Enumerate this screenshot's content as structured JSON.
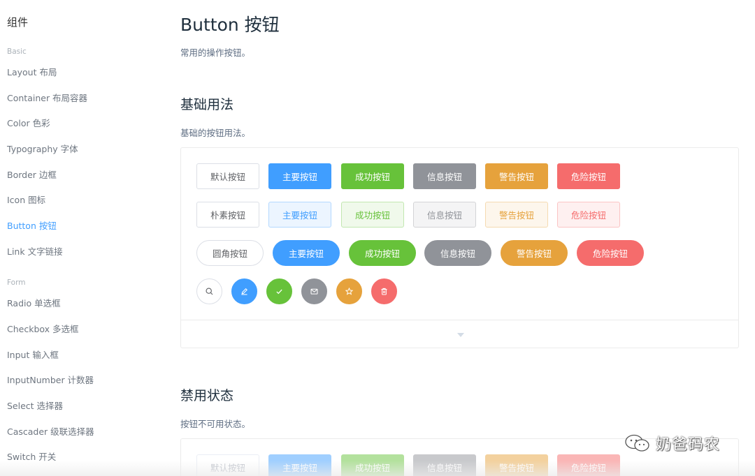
{
  "sidebar": {
    "title": "组件",
    "groups": [
      {
        "label": "Basic",
        "items": [
          {
            "label": "Layout 布局"
          },
          {
            "label": "Container 布局容器"
          },
          {
            "label": "Color 色彩"
          },
          {
            "label": "Typography 字体"
          },
          {
            "label": "Border 边框"
          },
          {
            "label": "Icon 图标"
          },
          {
            "label": "Button 按钮",
            "active": true
          },
          {
            "label": "Link 文字链接"
          }
        ]
      },
      {
        "label": "Form",
        "items": [
          {
            "label": "Radio 单选框"
          },
          {
            "label": "Checkbox 多选框"
          },
          {
            "label": "Input 输入框"
          },
          {
            "label": "InputNumber 计数器"
          },
          {
            "label": "Select 选择器"
          },
          {
            "label": "Cascader 级联选择器"
          },
          {
            "label": "Switch 开关"
          }
        ]
      }
    ]
  },
  "main": {
    "title": "Button 按钮",
    "description": "常用的操作按钮。",
    "sections": [
      {
        "heading": "基础用法",
        "description": "基础的按钮用法。",
        "rows": [
          {
            "kind": "default",
            "labels": [
              "默认按钮",
              "主要按钮",
              "成功按钮",
              "信息按钮",
              "警告按钮",
              "危险按钮"
            ]
          },
          {
            "kind": "plain",
            "labels": [
              "朴素按钮",
              "主要按钮",
              "成功按钮",
              "信息按钮",
              "警告按钮",
              "危险按钮"
            ]
          },
          {
            "kind": "round",
            "labels": [
              "圆角按钮",
              "主要按钮",
              "成功按钮",
              "信息按钮",
              "警告按钮",
              "危险按钮"
            ]
          },
          {
            "kind": "circle",
            "icons": [
              "search-icon",
              "edit-icon",
              "check-icon",
              "message-icon",
              "star-icon",
              "delete-icon"
            ]
          }
        ]
      },
      {
        "heading": "禁用状态",
        "description": "按钮不可用状态。",
        "rows": [
          {
            "kind": "disabled",
            "labels": [
              "默认按钮",
              "主要按钮",
              "成功按钮",
              "信息按钮",
              "警告按钮",
              "危险按钮"
            ]
          }
        ]
      }
    ]
  },
  "colors": {
    "primary": "#409eff",
    "success": "#67c23a",
    "info": "#909399",
    "warning": "#e6a23c",
    "danger": "#f56c6c"
  },
  "watermark": {
    "text": "奶爸码农"
  }
}
